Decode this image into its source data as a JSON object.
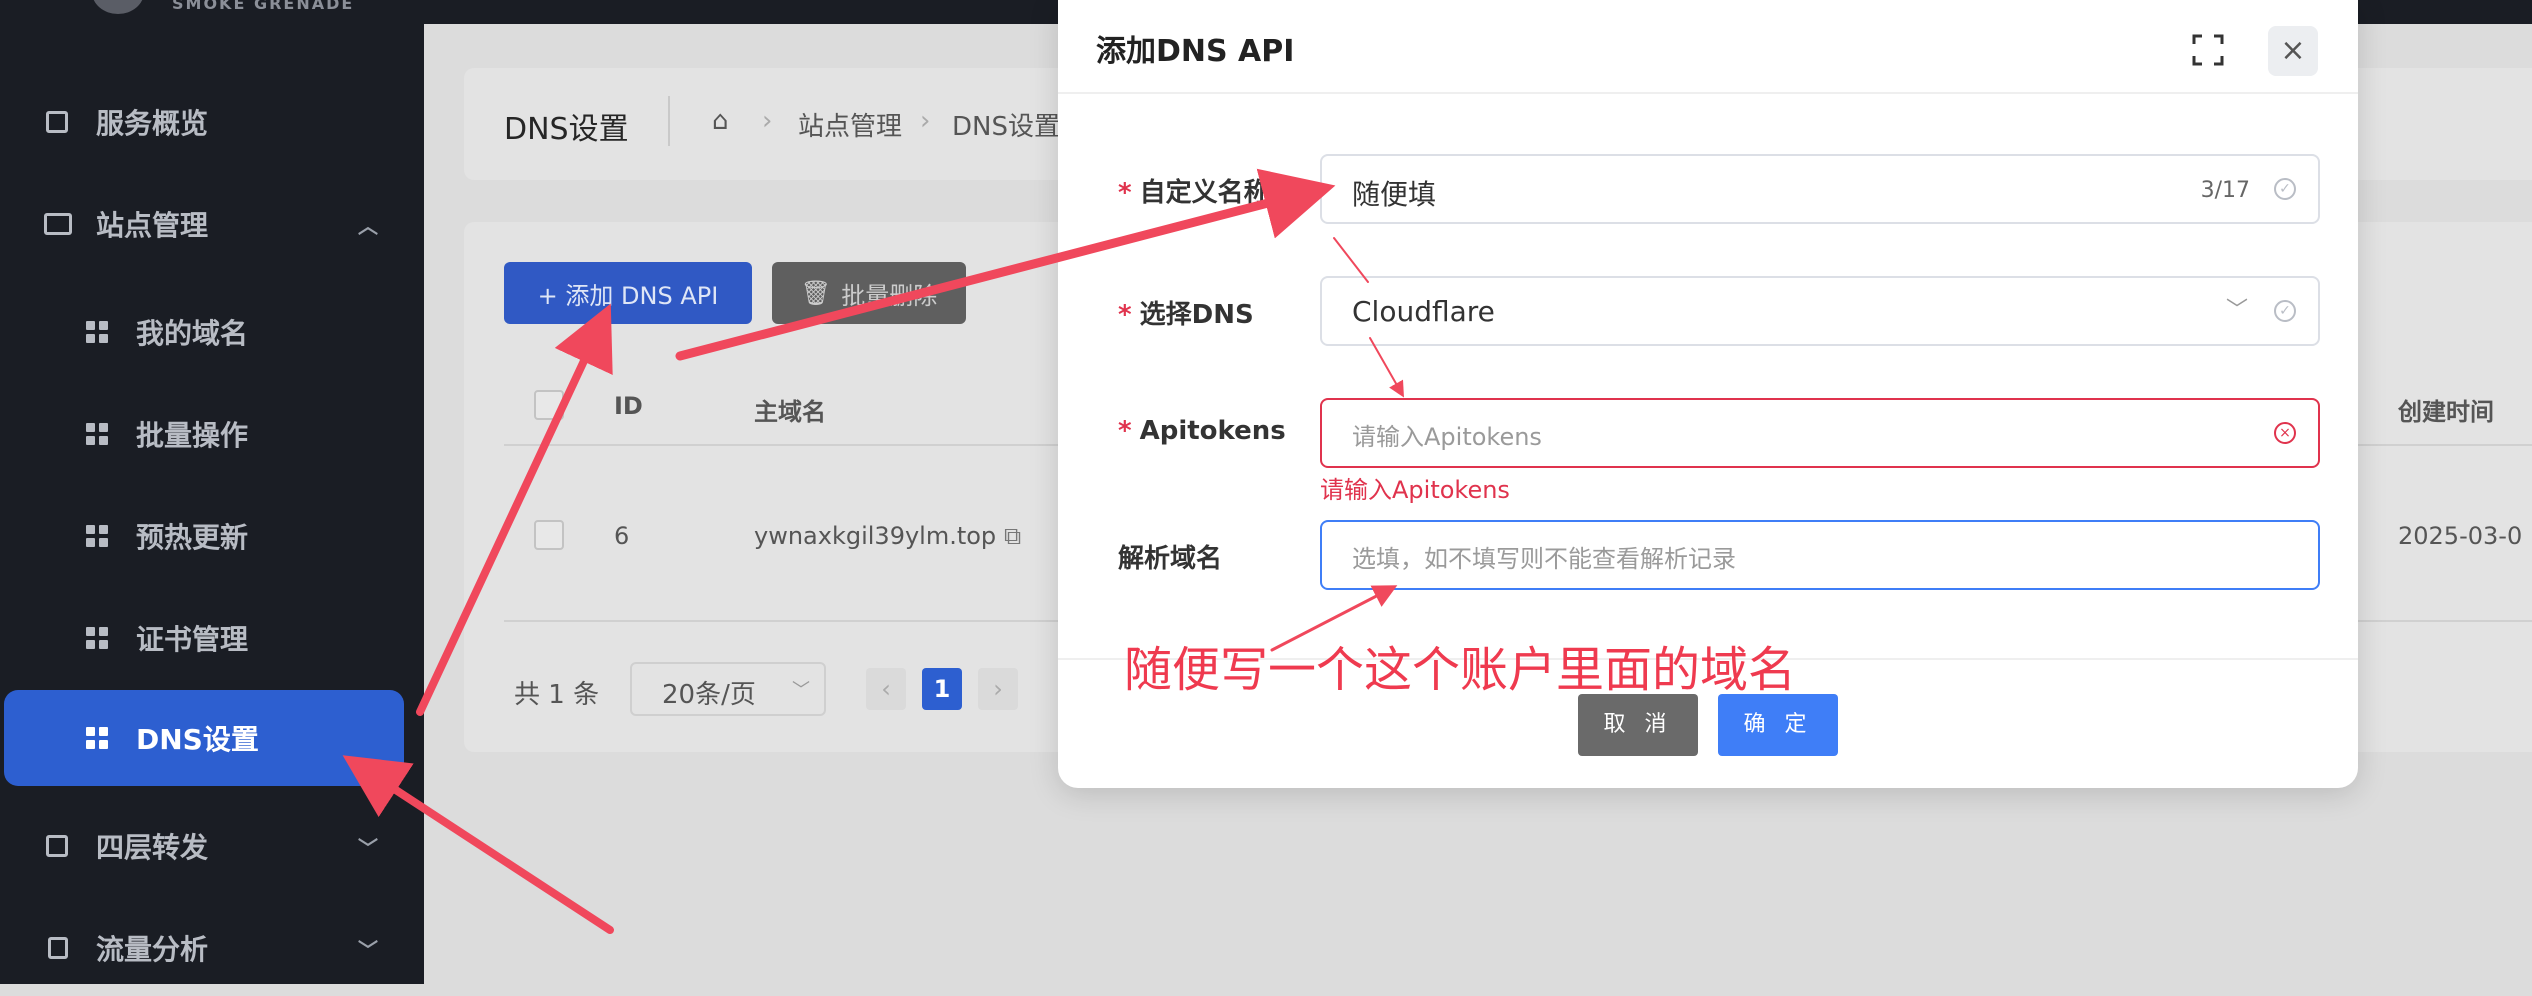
{
  "sidebar": {
    "brand": "SMOKE GRENADE",
    "items": [
      {
        "label": "服务概览",
        "icon": "chart-icon"
      },
      {
        "label": "站点管理",
        "icon": "monitor-icon"
      },
      {
        "label": "我的域名",
        "icon": "grid-icon"
      },
      {
        "label": "批量操作",
        "icon": "grid-icon"
      },
      {
        "label": "预热更新",
        "icon": "grid-icon"
      },
      {
        "label": "证书管理",
        "icon": "grid-icon"
      },
      {
        "label": "DNS设置",
        "icon": "grid-icon",
        "active": true
      },
      {
        "label": "四层转发",
        "icon": "share-icon"
      },
      {
        "label": "流量分析",
        "icon": "document-icon"
      }
    ]
  },
  "header": {
    "title": "DNS设置",
    "breadcrumb": [
      "站点管理",
      "DNS设置"
    ]
  },
  "toolbar": {
    "add_label": "+ 添加 DNS API",
    "delete_label": "批量删除"
  },
  "table": {
    "columns": [
      "ID",
      "主域名",
      "创建时间"
    ],
    "rows": [
      {
        "id": "6",
        "domain": "ywnaxkgil39ylm.top",
        "created": "2025-03-0"
      }
    ]
  },
  "pagination": {
    "total": "共 1 条",
    "page_size": "20条/页",
    "current_page": "1"
  },
  "modal": {
    "title": "添加DNS API",
    "fields": {
      "name_label": "自定义名称",
      "name_value": "随便填",
      "name_count": "3/17",
      "dns_label": "选择DNS",
      "dns_value": "Cloudflare",
      "token_label": "Apitokens",
      "token_placeholder": "请输入Apitokens",
      "token_error": "请输入Apitokens",
      "domain_label": "解析域名",
      "domain_placeholder": "选填，如不填写则不能查看解析记录"
    },
    "cancel_label": "取 消",
    "confirm_label": "确 定"
  },
  "annotation": {
    "note": "随便写一个这个账户里面的域名",
    "arrow_color": "#f0485c"
  },
  "colors": {
    "primary": "#2d5fd0",
    "error": "#e0334d",
    "sidebar_bg": "#1a1d24"
  }
}
